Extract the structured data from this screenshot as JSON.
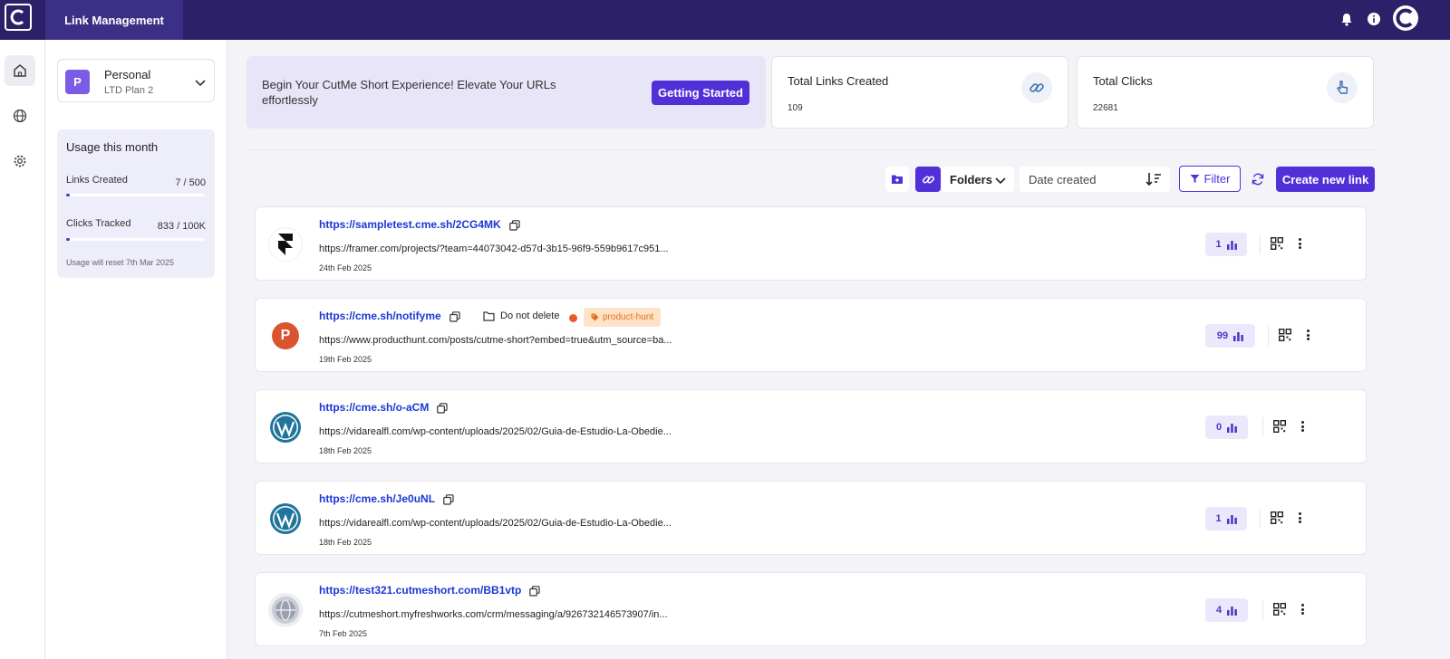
{
  "topbar": {
    "app_tab": "Link Management",
    "icons": [
      "bell-icon",
      "info-icon",
      "avatar"
    ]
  },
  "rail": {
    "items": [
      "home-icon",
      "globe-icon",
      "gear-icon"
    ]
  },
  "workspace": {
    "badge": "P",
    "name": "Personal",
    "plan": "LTD Plan 2"
  },
  "usage": {
    "title": "Usage this month",
    "links_label": "Links Created",
    "links_value": "7 / 500",
    "links_fraction": 0.014,
    "clicks_label": "Clicks Tracked",
    "clicks_value": "833 / 100K",
    "clicks_fraction": 0.008,
    "reset_text": "Usage will reset 7th Mar 2025"
  },
  "banner": {
    "text": "Begin Your CutMe Short Experience! Elevate Your URLs effortlessly",
    "button": "Getting Started"
  },
  "stats": {
    "links_title": "Total Links Created",
    "links_value": "109",
    "clicks_title": "Total Clicks",
    "clicks_value": "22681"
  },
  "toolbar": {
    "folders_label": "Folders",
    "sort_label": "Date created",
    "filter_label": "Filter",
    "create_label": "Create new link"
  },
  "links": [
    {
      "short": "https://sampletest.cme.sh/2CG4MK",
      "long": "https://framer.com/projects/?team=44073042-d57d-3b15-96f9-559b9617c951...",
      "date": "24th Feb 2025",
      "clicks": "1",
      "logo": "framer-logo"
    },
    {
      "short": "https://cme.sh/notifyme",
      "long": "https://www.producthunt.com/posts/cutme-short?embed=true&utm_source=ba...",
      "date": "19th Feb 2025",
      "clicks": "99",
      "logo": "producthunt-logo",
      "logo_letter": "P",
      "folder": "Do not delete",
      "tag": "product-hunt"
    },
    {
      "short": "https://cme.sh/o-aCM",
      "long": "https://vidarealfl.com/wp-content/uploads/2025/02/Guia-de-Estudio-La-Obedie...",
      "date": "18th Feb 2025",
      "clicks": "0",
      "logo": "wordpress-logo"
    },
    {
      "short": "https://cme.sh/Je0uNL",
      "long": "https://vidarealfl.com/wp-content/uploads/2025/02/Guia-de-Estudio-La-Obedie...",
      "date": "18th Feb 2025",
      "clicks": "1",
      "logo": "wordpress-logo"
    },
    {
      "short": "https://test321.cutmeshort.com/BB1vtp",
      "long": "https://cutmeshort.myfreshworks.com/crm/messaging/a/926732146573907/in...",
      "date": "7th Feb 2025",
      "clicks": "4",
      "logo": "globe-logo"
    }
  ],
  "colors": {
    "topbar": "#2c2168",
    "primary": "#5130d8",
    "link": "#1a37d6",
    "tag_bg": "#ffe3c6",
    "tag_text": "#e06f1e"
  }
}
